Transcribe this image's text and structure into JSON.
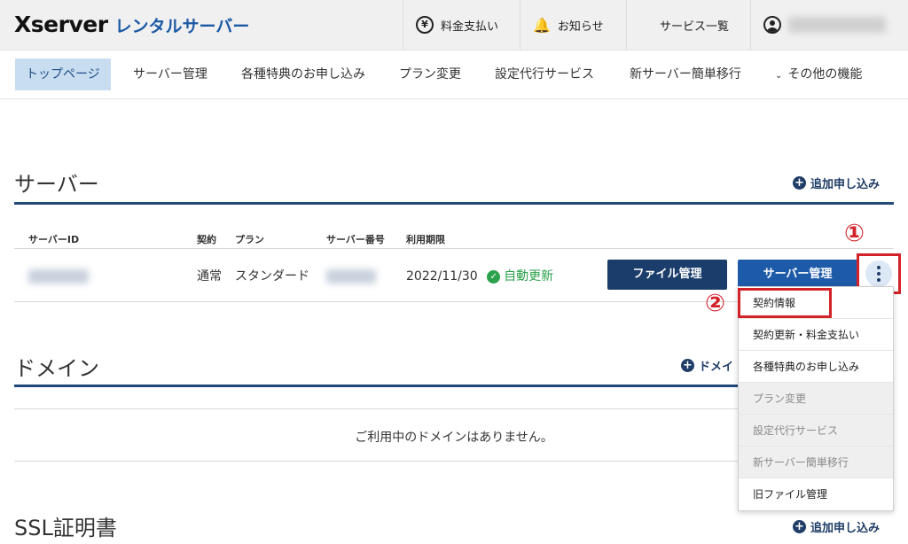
{
  "header": {
    "brand": "Xserver",
    "brand_sub": "レンタルサーバー",
    "payment": "料金支払い",
    "notice": "お知らせ",
    "services": "サービス一覧"
  },
  "icons": {
    "payment": "yen-icon",
    "notice": "bell-icon",
    "services": "grid-icon",
    "user": "user-icon",
    "kebab": "kebab-menu-icon",
    "add": "plus-circle-icon",
    "renew": "check-circle-icon",
    "more": "chevron-down-icon"
  },
  "nav": {
    "items": [
      "トップページ",
      "サーバー管理",
      "各種特典のお申し込み",
      "プラン変更",
      "設定代行サービス",
      "新サーバー簡単移行",
      "その他の機能"
    ]
  },
  "server": {
    "title": "サーバー",
    "add_label": "追加申し込み",
    "columns": {
      "server_id": "サーバーID",
      "contract": "契約",
      "plan": "プラン",
      "server_no": "サーバー番号",
      "period": "利用期限"
    },
    "row": {
      "contract": "通常",
      "plan": "スタンダード",
      "period": "2022/11/30",
      "renew": "自動更新"
    },
    "file_button": "ファイル管理",
    "manage_button": "サーバー管理"
  },
  "menu": {
    "items": [
      {
        "label": "契約情報",
        "disabled": false
      },
      {
        "label": "契約更新・料金支払い",
        "disabled": false
      },
      {
        "label": "各種特典のお申し込み",
        "disabled": false
      },
      {
        "label": "プラン変更",
        "disabled": true
      },
      {
        "label": "設定代行サービス",
        "disabled": true
      },
      {
        "label": "新サーバー簡単移行",
        "disabled": true
      },
      {
        "label": "旧ファイル管理",
        "disabled": false
      }
    ]
  },
  "annotations": {
    "step1": "①",
    "step2": "②"
  },
  "domain": {
    "title": "ドメイン",
    "add_label_partial": "ドメイ",
    "empty": "ご利用中のドメインはありません。"
  },
  "ssl": {
    "title": "SSL証明書",
    "add_label": "追加申し込み"
  },
  "colors": {
    "navy": "#1b3d6b",
    "primary": "#1d5aa8",
    "annotation_red": "#d3222a",
    "success": "#2aa14a"
  }
}
